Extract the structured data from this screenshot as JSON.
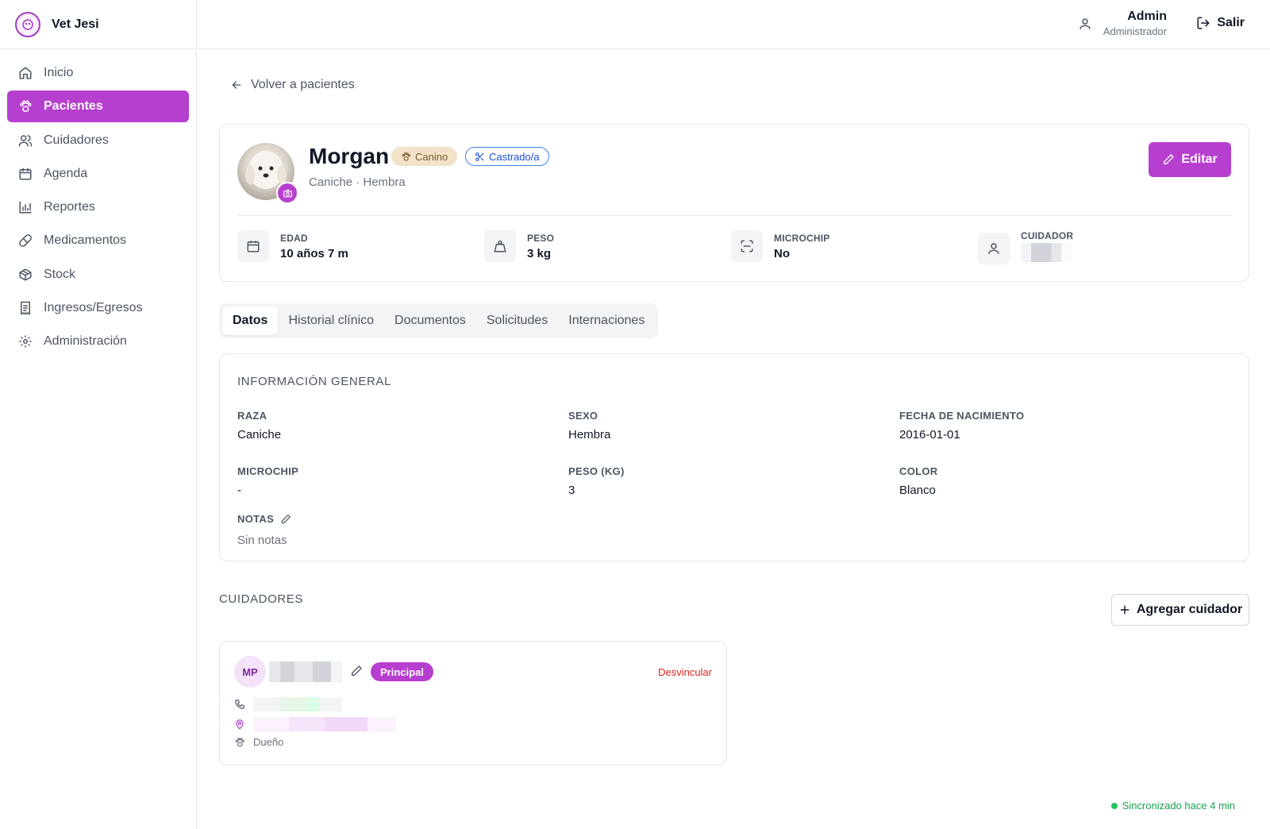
{
  "brand": {
    "name": "Vet Jesi"
  },
  "sidebar": {
    "items": [
      {
        "label": "Inicio",
        "icon": "home-icon",
        "active": false
      },
      {
        "label": "Pacientes",
        "icon": "paw-icon",
        "active": true
      },
      {
        "label": "Cuidadores",
        "icon": "users-icon",
        "active": false
      },
      {
        "label": "Agenda",
        "icon": "calendar-icon",
        "active": false
      },
      {
        "label": "Reportes",
        "icon": "bar-chart-icon",
        "active": false
      },
      {
        "label": "Medicamentos",
        "icon": "pill-icon",
        "active": false
      },
      {
        "label": "Stock",
        "icon": "box-icon",
        "active": false
      },
      {
        "label": "Ingresos/Egresos",
        "icon": "receipt-icon",
        "active": false
      },
      {
        "label": "Administración",
        "icon": "gear-icon",
        "active": false
      }
    ]
  },
  "header": {
    "user_name": "Admin",
    "user_role": "Administrador",
    "logout_label": "Salir"
  },
  "back_label": "Volver a pacientes",
  "patient": {
    "name": "Morgan",
    "species_badge": "Canino",
    "neutered_badge": "Castrado/a",
    "subtitle": "Caniche · Hembra",
    "edit_label": "Editar",
    "stats": {
      "age_label": "EDAD",
      "age_value": "10 años 7 m",
      "weight_label": "PESO",
      "weight_value": "3 kg",
      "chip_label": "MICROCHIP",
      "chip_value": "No",
      "caregiver_label": "CUIDADOR"
    }
  },
  "tabs": [
    "Datos",
    "Historial clínico",
    "Documentos",
    "Solicitudes",
    "Internaciones"
  ],
  "info": {
    "title": "INFORMACIÓN GENERAL",
    "breed_label": "RAZA",
    "breed_value": "Caniche",
    "sex_label": "SEXO",
    "sex_value": "Hembra",
    "birth_label": "FECHA DE NACIMIENTO",
    "birth_value": "2016-01-01",
    "chip_label": "MICROCHIP",
    "chip_value": "-",
    "weight_label": "PESO (KG)",
    "weight_value": "3",
    "color_label": "COLOR",
    "color_value": "Blanco",
    "notes_label": "NOTAS",
    "notes_value": "Sin notas"
  },
  "caregivers": {
    "title": "CUIDADORES",
    "add_label": "Agregar cuidador",
    "card": {
      "initials": "MP",
      "badge": "Principal",
      "unlink": "Desvincular",
      "relation": "Dueño"
    }
  },
  "sync_status": "Sincronizado hace 4 min",
  "colors": {
    "accent": "#b73fcf",
    "danger": "#dc2626",
    "success": "#16a34a"
  }
}
